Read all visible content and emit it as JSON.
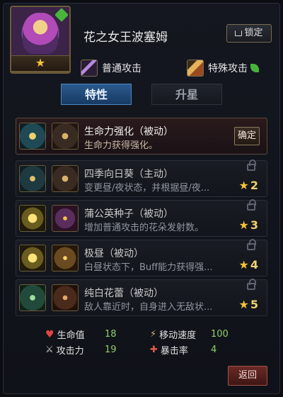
{
  "hero": {
    "name": "花之女王波塞姆",
    "star_rank": "★",
    "lock_button": "锁定"
  },
  "attacks": {
    "normal": "普通攻击",
    "special": "特殊攻击"
  },
  "tabs": [
    {
      "label": "特性",
      "active": true
    },
    {
      "label": "升星",
      "active": false
    }
  ],
  "skills": [
    {
      "title": "生命力强化（被动）",
      "desc": "生命力获得强化。",
      "action": "确定",
      "locked": false
    },
    {
      "title": "四季向日葵（主动）",
      "desc": "变更昼/夜状态，并根据昼/夜...",
      "locked": true,
      "required_stars": "2"
    },
    {
      "title": "蒲公英种子（被动）",
      "desc": "增加普通攻击的花朵发射数。",
      "locked": true,
      "required_stars": "3"
    },
    {
      "title": "极昼（被动）",
      "desc": "白昼状态下，Buff能力获得强...",
      "locked": true,
      "required_stars": "4"
    },
    {
      "title": "纯白花蕾（被动）",
      "desc": "敌人靠近时，自身进入无敌状...",
      "locked": true,
      "required_stars": "5"
    }
  ],
  "stats": {
    "hp_label": "生命值",
    "hp_value": "18",
    "atk_label": "攻击力",
    "atk_value": "19",
    "speed_label": "移动速度",
    "speed_value": "100",
    "crit_label": "暴击率",
    "crit_value": "4"
  },
  "return_button": "返回",
  "colors": {
    "accent_blue": "#2b5a8e",
    "star_gold": "#f4c23a",
    "stat_green": "#8fd06a"
  }
}
